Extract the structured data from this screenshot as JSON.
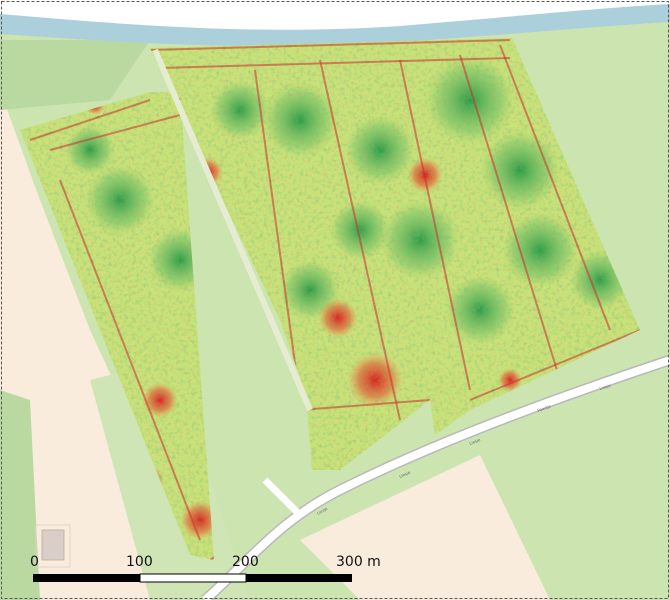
{
  "map": {
    "land_colors": {
      "grass": "#cce4b0",
      "farmland": "#f9ecdc",
      "water": "#acd0db",
      "road": "#ffffff",
      "road_edge": "#b8b8b8",
      "building": "#d9cfc8"
    },
    "ndvi_palette": [
      "#d7191c",
      "#f49b5a",
      "#fee08b",
      "#d9ef8b",
      "#91cf60",
      "#1a9641"
    ],
    "road_labels": [
      "Liesje",
      "Liesje",
      "Liesje",
      "Poortje",
      "Liesje"
    ],
    "frame_style": "dashed"
  },
  "scalebar": {
    "labels": [
      "0",
      "100",
      "200",
      "300 m"
    ]
  }
}
